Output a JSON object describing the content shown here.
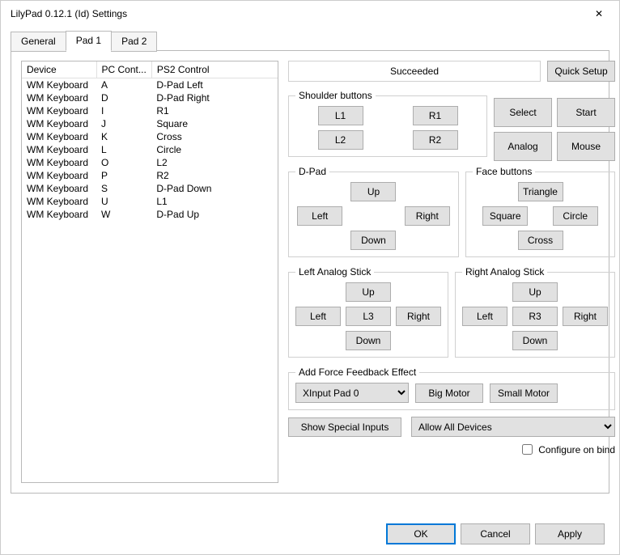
{
  "window": {
    "title": "LilyPad 0.12.1 (Id) Settings"
  },
  "tabs": [
    "General",
    "Pad 1",
    "Pad 2"
  ],
  "active_tab": 1,
  "bindings": {
    "headers": [
      "Device",
      "PC Cont...",
      "PS2 Control"
    ],
    "rows": [
      [
        "WM Keyboard",
        "A",
        "D-Pad Left"
      ],
      [
        "WM Keyboard",
        "D",
        "D-Pad Right"
      ],
      [
        "WM Keyboard",
        "I",
        "R1"
      ],
      [
        "WM Keyboard",
        "J",
        "Square"
      ],
      [
        "WM Keyboard",
        "K",
        "Cross"
      ],
      [
        "WM Keyboard",
        "L",
        "Circle"
      ],
      [
        "WM Keyboard",
        "O",
        "L2"
      ],
      [
        "WM Keyboard",
        "P",
        "R2"
      ],
      [
        "WM Keyboard",
        "S",
        "D-Pad Down"
      ],
      [
        "WM Keyboard",
        "U",
        "L1"
      ],
      [
        "WM Keyboard",
        "W",
        "D-Pad Up"
      ]
    ]
  },
  "status": "Succeeded",
  "quick_setup": "Quick Setup",
  "groups": {
    "shoulder": {
      "legend": "Shoulder buttons",
      "l1": "L1",
      "r1": "R1",
      "l2": "L2",
      "r2": "R2"
    },
    "side": {
      "select": "Select",
      "start": "Start",
      "analog": "Analog",
      "mouse": "Mouse"
    },
    "dpad": {
      "legend": "D-Pad",
      "up": "Up",
      "left": "Left",
      "right": "Right",
      "down": "Down"
    },
    "face": {
      "legend": "Face buttons",
      "triangle": "Triangle",
      "square": "Square",
      "circle": "Circle",
      "cross": "Cross"
    },
    "lstick": {
      "legend": "Left Analog Stick",
      "up": "Up",
      "left": "Left",
      "l3": "L3",
      "right": "Right",
      "down": "Down"
    },
    "rstick": {
      "legend": "Right Analog Stick",
      "up": "Up",
      "left": "Left",
      "r3": "R3",
      "right": "Right",
      "down": "Down"
    },
    "ff": {
      "legend": "Add Force Feedback Effect",
      "device": "XInput Pad 0",
      "big": "Big Motor",
      "small": "Small Motor"
    }
  },
  "special_inputs": "Show Special Inputs",
  "device_filter": "Allow All Devices",
  "configure_on_bind": "Configure on bind",
  "dialog": {
    "ok": "OK",
    "cancel": "Cancel",
    "apply": "Apply"
  }
}
